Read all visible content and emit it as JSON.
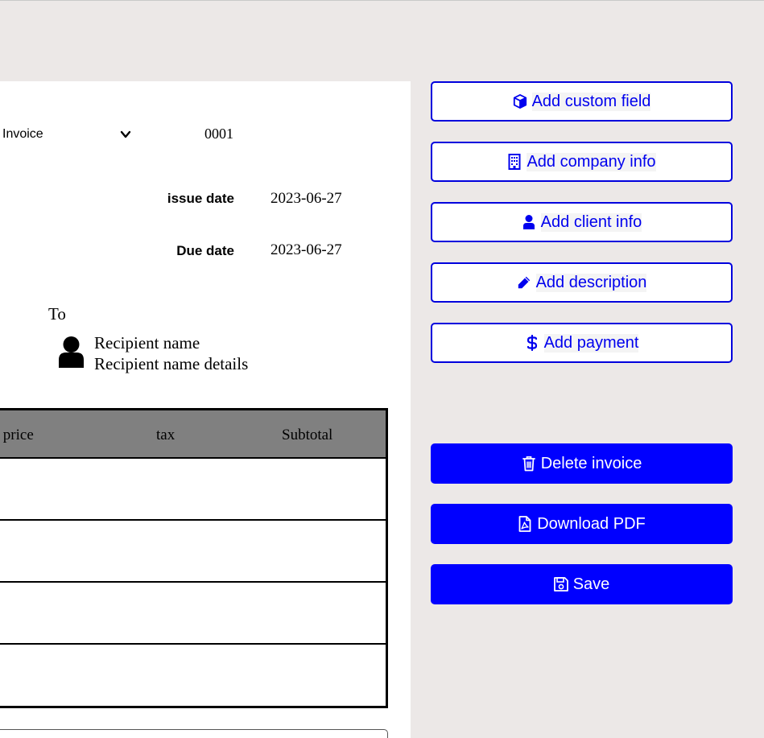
{
  "invoice": {
    "doc_type": "Invoice",
    "number": "0001",
    "issue_date_label": "issue date",
    "issue_date": "2023-06-27",
    "due_date_label": "Due date",
    "due_date": "2023-06-27"
  },
  "recipient": {
    "to_label": "To",
    "name": "Recipient name",
    "details": "Recipient name details"
  },
  "items_table": {
    "columns": [
      "nit price",
      "tax",
      "Subtotal"
    ],
    "rows": [
      [],
      [],
      [],
      []
    ]
  },
  "actions": {
    "add_custom_field": "Add custom field",
    "add_company_info": "Add company info",
    "add_client_info": "Add client info",
    "add_description": "Add description",
    "add_payment": "Add payment",
    "delete_invoice": "Delete invoice",
    "download_pdf": "Download PDF",
    "save": "Save"
  },
  "icons": {
    "custom_field": "cube-icon",
    "company_info": "building-icon",
    "client_info": "user-icon",
    "description": "pencil-icon",
    "payment": "dollar-icon",
    "delete": "trash-icon",
    "download": "file-pdf-icon",
    "save": "floppy-icon",
    "recipient": "user-icon",
    "doc_type": "chevron-down-icon"
  },
  "colors": {
    "accent": "#0000ff",
    "page_bg": "#ece8e7",
    "table_header": "#808080"
  }
}
